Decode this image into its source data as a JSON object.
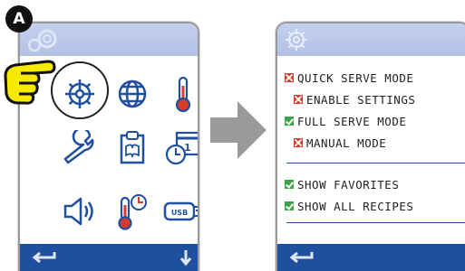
{
  "left_screen": {
    "badge": "A",
    "icons": [
      "settings-gear-icon",
      "globe-icon",
      "thermometer-icon",
      "wrench-icon",
      "manual-book-icon",
      "calendar-clock-icon",
      "speaker-icon",
      "thermometer-timer-icon",
      "usb-drive-icon"
    ],
    "usb_label": "USB",
    "calendar_day": "1"
  },
  "right_screen": {
    "menu": [
      {
        "label": "QUICK SERVE MODE",
        "state": "off"
      },
      {
        "label": "ENABLE SETTINGS",
        "state": "off"
      },
      {
        "label": "FULL SERVE MODE",
        "state": "on"
      },
      {
        "label": "MANUAL MODE",
        "state": "off"
      },
      {
        "label": "SHOW FAVORITES",
        "state": "on"
      },
      {
        "label": "SHOW ALL RECIPES",
        "state": "on"
      }
    ]
  },
  "colors": {
    "top_bar": "#b8c5e8",
    "bottom_bar": "#1f4f9f",
    "icon_blue": "#1f4f9f",
    "check_green": "#3aa54a",
    "cross_red": "#d63b2c",
    "hand_yellow": "#f5ea00",
    "arrow_gray": "#9a9a9a"
  }
}
